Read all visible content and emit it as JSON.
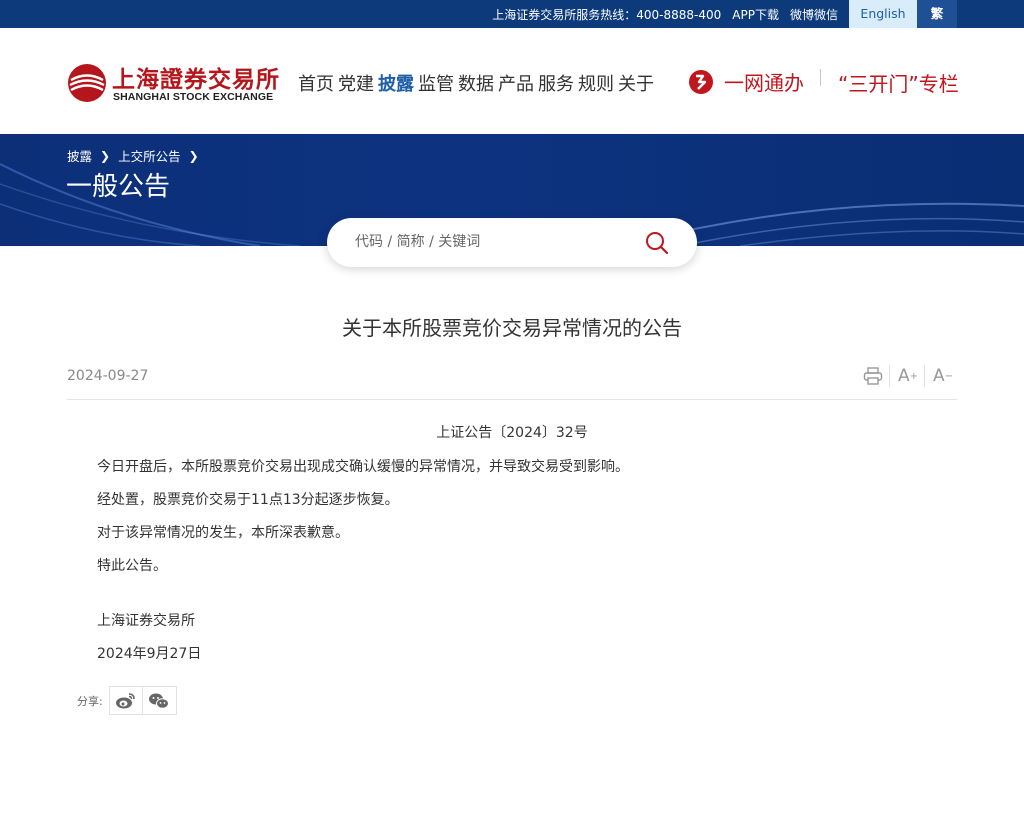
{
  "topbar": {
    "hotline": "上海证券交易所服务热线：400-8888-400",
    "app_download": "APP下载",
    "weibo_wechat": "微博微信",
    "english": "English",
    "traditional": "繁"
  },
  "logo": {
    "cn": "上海證券交易所",
    "en": "SHANGHAI STOCK EXCHANGE"
  },
  "nav": {
    "items": [
      "首页",
      "党建",
      "披露",
      "监管",
      "数据",
      "产品",
      "服务",
      "规则",
      "关于"
    ],
    "active_index": 2
  },
  "quick_links": {
    "yiwang": "一网通办",
    "sankai": "“三开门”专栏"
  },
  "breadcrumb": [
    "披露",
    "上交所公告"
  ],
  "banner_title": "一般公告",
  "search": {
    "placeholder": "代码 / 简称 / 关键词"
  },
  "article": {
    "title": "关于本所股票竞价交易异常情况的公告",
    "date": "2024-09-27",
    "doc_number": "上证公告〔2024〕32号",
    "paragraphs": [
      "今日开盘后，本所股票竞价交易出现成交确认缓慢的异常情况，并导致交易受到影响。",
      "经处置，股票竞价交易于11点13分起逐步恢复。",
      "对于该异常情况的发生，本所深表歉意。",
      "特此公告。"
    ],
    "signature": "上海证券交易所",
    "signature_date": "2024年9月27日"
  },
  "tools": {
    "font_increase": "A",
    "font_decrease": "A"
  },
  "share": {
    "label": "分享:"
  },
  "colors": {
    "topbar": "#0c3a7a",
    "brand_red": "#b4161b",
    "nav_active": "#1f5ea8",
    "banner": "#0d3380"
  }
}
